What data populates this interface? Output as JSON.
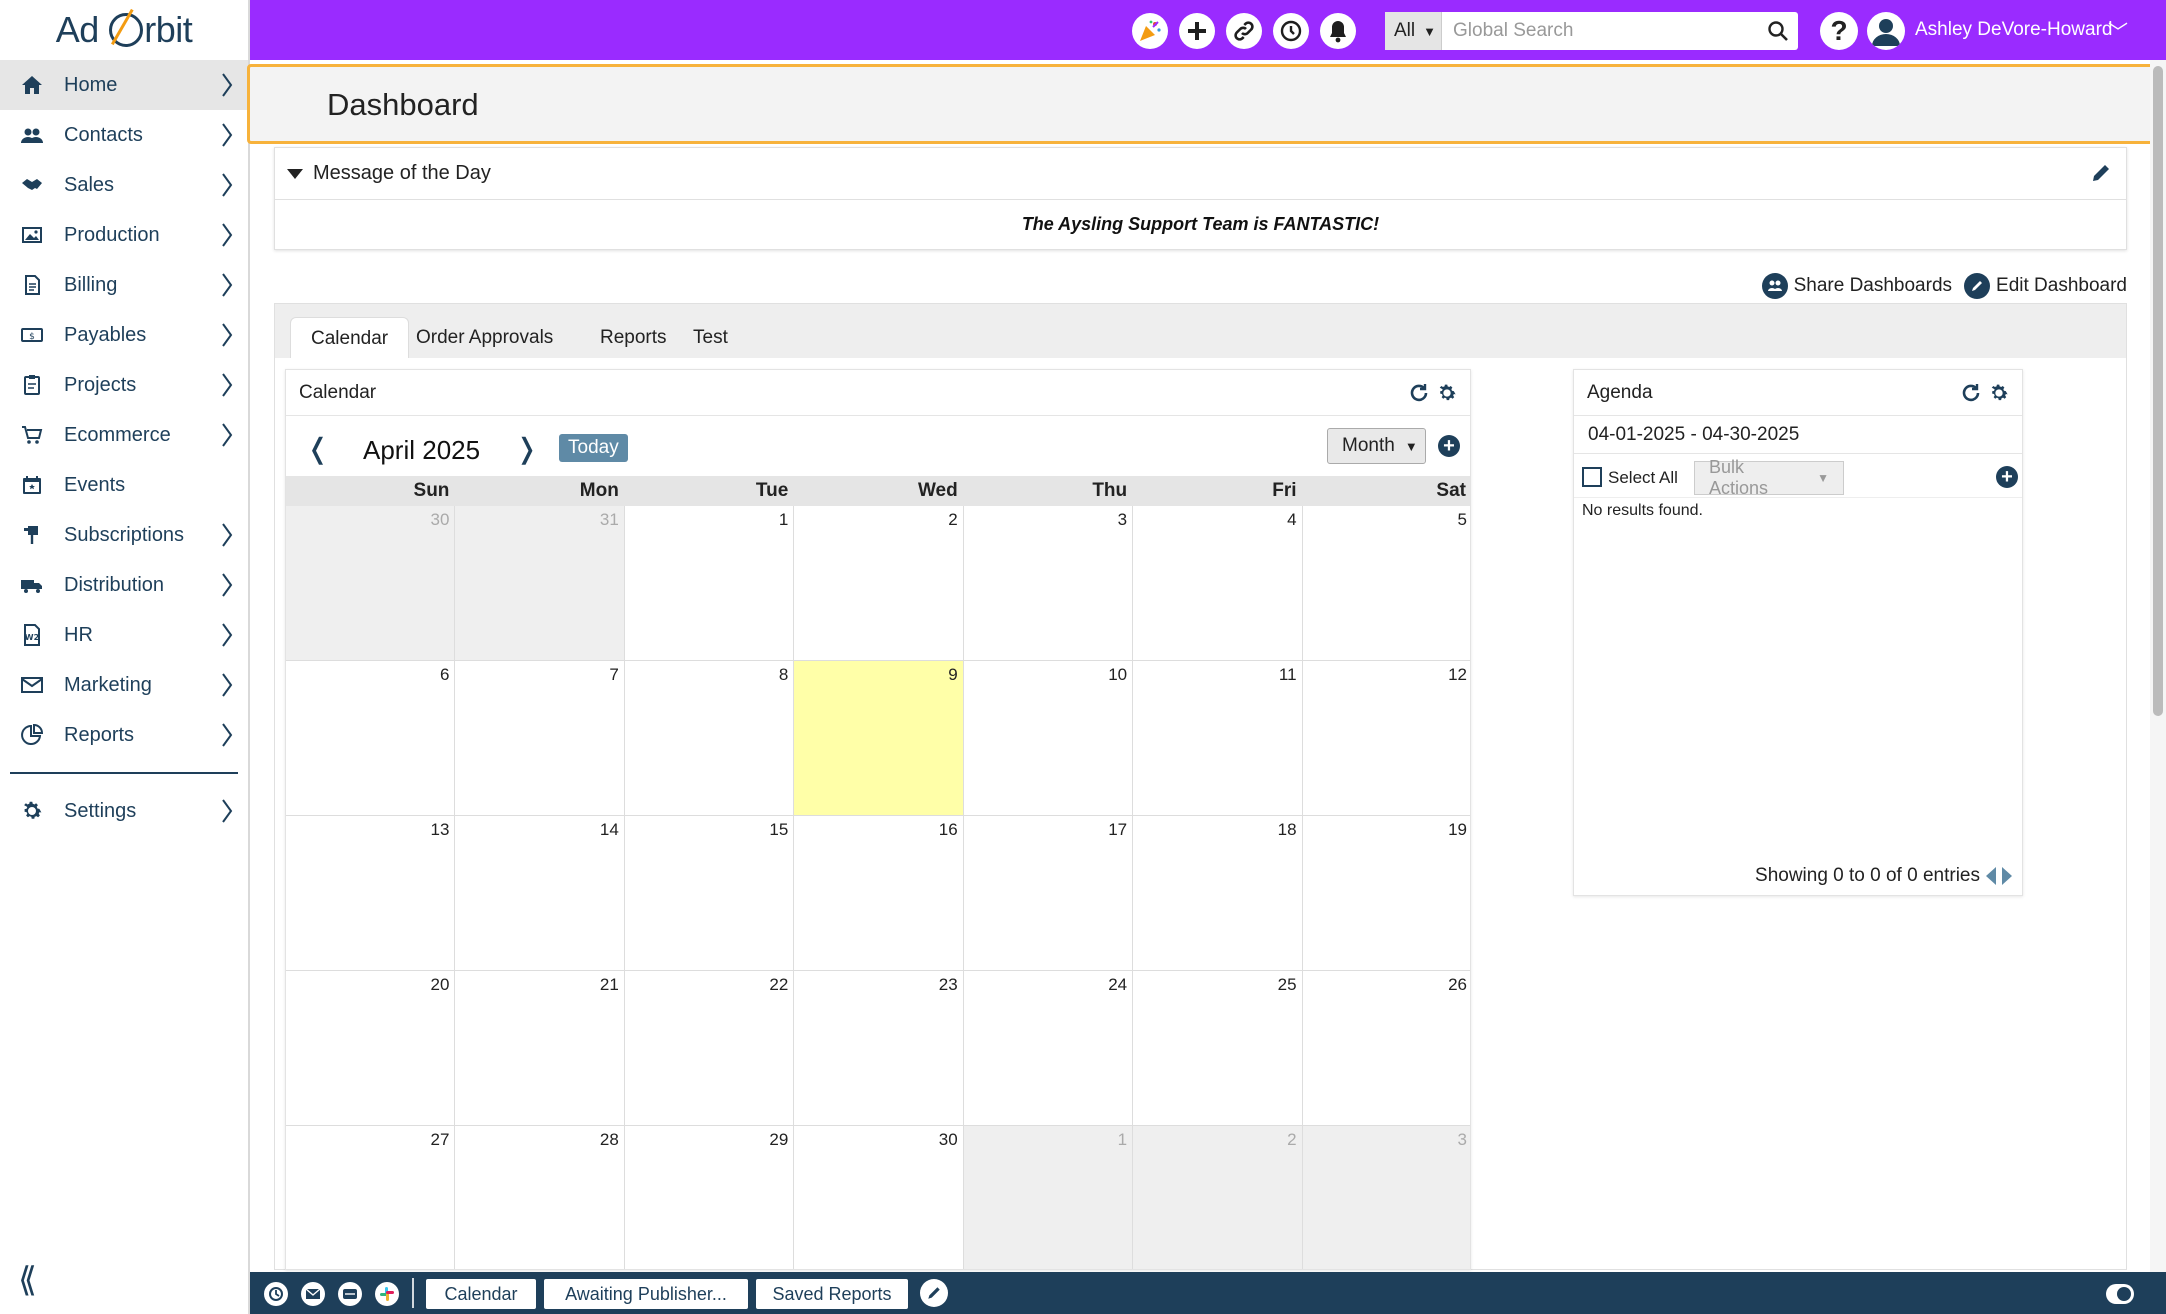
{
  "app": {
    "logo_left": "Ad",
    "logo_right": "rbit"
  },
  "sidebar": {
    "items": [
      {
        "label": "Home",
        "icon": "home-icon",
        "active": true
      },
      {
        "label": "Contacts",
        "icon": "contacts-icon"
      },
      {
        "label": "Sales",
        "icon": "handshake-icon"
      },
      {
        "label": "Production",
        "icon": "image-icon"
      },
      {
        "label": "Billing",
        "icon": "invoice-icon"
      },
      {
        "label": "Payables",
        "icon": "money-icon"
      },
      {
        "label": "Projects",
        "icon": "clipboard-icon"
      },
      {
        "label": "Ecommerce",
        "icon": "cart-icon"
      },
      {
        "label": "Events",
        "icon": "calendar-icon"
      },
      {
        "label": "Subscriptions",
        "icon": "mailbox-icon"
      },
      {
        "label": "Distribution",
        "icon": "truck-icon"
      },
      {
        "label": "HR",
        "icon": "w2-form-icon"
      },
      {
        "label": "Marketing",
        "icon": "envelope-icon"
      },
      {
        "label": "Reports",
        "icon": "pie-chart-icon"
      }
    ],
    "settings": {
      "label": "Settings",
      "icon": "gear-icon"
    }
  },
  "topbar": {
    "search_scope": "All",
    "search_placeholder": "Global Search",
    "help": "?",
    "user_name": "Ashley DeVore-Howard"
  },
  "header": {
    "title": "Dashboard"
  },
  "motd": {
    "title": "Message of the Day",
    "message": "The Aysling Support Team is FANTASTIC!"
  },
  "dashboard_actions": {
    "share": "Share Dashboards",
    "edit": "Edit Dashboard"
  },
  "tabs": [
    {
      "label": "Calendar",
      "active": true
    },
    {
      "label": "Order Approvals"
    },
    {
      "label": "Reports"
    },
    {
      "label": "Test"
    }
  ],
  "calendar": {
    "title": "Calendar",
    "month_label": "April 2025",
    "today_label": "Today",
    "view": "Month",
    "weekdays": [
      "Sun",
      "Mon",
      "Tue",
      "Wed",
      "Thu",
      "Fri",
      "Sat"
    ],
    "weeks": [
      [
        {
          "d": "30",
          "other": true
        },
        {
          "d": "31",
          "other": true
        },
        {
          "d": "1"
        },
        {
          "d": "2"
        },
        {
          "d": "3"
        },
        {
          "d": "4"
        },
        {
          "d": "5"
        }
      ],
      [
        {
          "d": "6"
        },
        {
          "d": "7"
        },
        {
          "d": "8"
        },
        {
          "d": "9",
          "today": true
        },
        {
          "d": "10"
        },
        {
          "d": "11"
        },
        {
          "d": "12"
        }
      ],
      [
        {
          "d": "13"
        },
        {
          "d": "14"
        },
        {
          "d": "15"
        },
        {
          "d": "16"
        },
        {
          "d": "17"
        },
        {
          "d": "18"
        },
        {
          "d": "19"
        }
      ],
      [
        {
          "d": "20"
        },
        {
          "d": "21"
        },
        {
          "d": "22"
        },
        {
          "d": "23"
        },
        {
          "d": "24"
        },
        {
          "d": "25"
        },
        {
          "d": "26"
        }
      ],
      [
        {
          "d": "27"
        },
        {
          "d": "28"
        },
        {
          "d": "29"
        },
        {
          "d": "30"
        },
        {
          "d": "1",
          "other": true
        },
        {
          "d": "2",
          "other": true
        },
        {
          "d": "3",
          "other": true
        }
      ]
    ]
  },
  "agenda": {
    "title": "Agenda",
    "range": "04-01-2025 - 04-30-2025",
    "select_all": "Select All",
    "bulk_actions": "Bulk Actions",
    "empty": "No results found.",
    "entries": "Showing 0 to 0 of 0 entries"
  },
  "bottombar": {
    "tabs": [
      "Calendar",
      "Awaiting Publisher...",
      "Saved Reports"
    ]
  },
  "colors": {
    "topbar": "#9a2bff",
    "navy": "#1e3f5a",
    "header_border": "#f7b23b",
    "today_cell": "#ffffa8"
  }
}
